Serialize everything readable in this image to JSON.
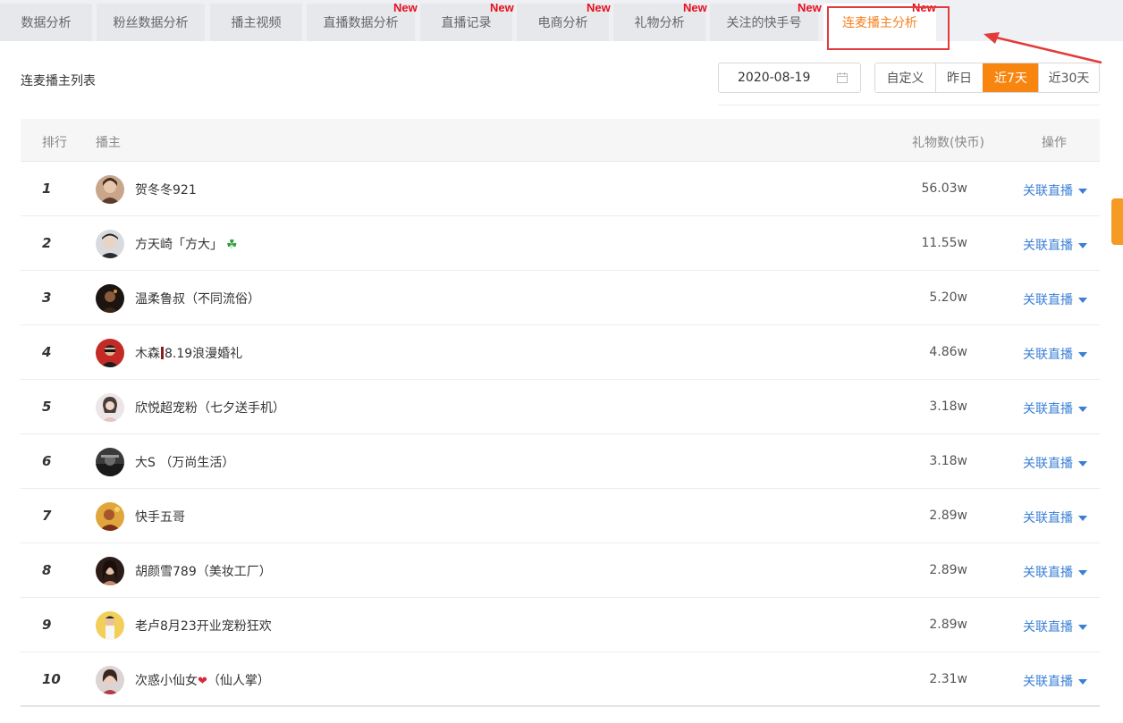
{
  "tabs": [
    {
      "label": "数据分析",
      "new": false,
      "active": false
    },
    {
      "label": "粉丝数据分析",
      "new": false,
      "active": false
    },
    {
      "label": "播主视频",
      "new": false,
      "active": false
    },
    {
      "label": "直播数据分析",
      "new": true,
      "active": false
    },
    {
      "label": "直播记录",
      "new": true,
      "active": false
    },
    {
      "label": "电商分析",
      "new": true,
      "active": false
    },
    {
      "label": "礼物分析",
      "new": true,
      "active": false
    },
    {
      "label": "关注的快手号",
      "new": true,
      "active": false
    },
    {
      "label": "连麦播主分析",
      "new": true,
      "active": true
    }
  ],
  "new_badge": "New",
  "list_title": "连麦播主列表",
  "date_value": "2020-08-19",
  "ranges": [
    {
      "label": "自定义",
      "active": false
    },
    {
      "label": "昨日",
      "active": false
    },
    {
      "label": "近7天",
      "active": true
    },
    {
      "label": "近30天",
      "active": false
    }
  ],
  "table": {
    "headers": {
      "rank": "排行",
      "streamer": "播主",
      "gifts": "礼物数(快币)",
      "action": "操作"
    },
    "action_label": "关联直播",
    "rows": [
      {
        "rank": "1",
        "name": "贺冬冬921",
        "gifts": "56.03w"
      },
      {
        "rank": "2",
        "name": "方天崎「方大」",
        "gifts": "11.55w"
      },
      {
        "rank": "3",
        "name": "温柔鲁叔（不同流俗）",
        "gifts": "5.20w"
      },
      {
        "rank": "4",
        "name_pre": "木森",
        "name_post": "8.19浪漫婚礼",
        "gifts": "4.86w"
      },
      {
        "rank": "5",
        "name": "欣悦超宠粉（七夕送手机）",
        "gifts": "3.18w"
      },
      {
        "rank": "6",
        "name": "大S （万尚生活）",
        "gifts": "3.18w"
      },
      {
        "rank": "7",
        "name": "快手五哥",
        "gifts": "2.89w"
      },
      {
        "rank": "8",
        "name": "胡颜雪789（美妆工厂）",
        "gifts": "2.89w"
      },
      {
        "rank": "9",
        "name": "老卢8月23开业宠粉狂欢",
        "gifts": "2.89w"
      },
      {
        "rank": "10",
        "name_pre": "次惑小仙女",
        "name_post": "（仙人掌）",
        "gifts": "2.31w"
      }
    ]
  },
  "colors": {
    "accent": "#f7850f",
    "link": "#3a7fd5",
    "badge": "#e8101f",
    "highlight": "#e23b3b"
  }
}
